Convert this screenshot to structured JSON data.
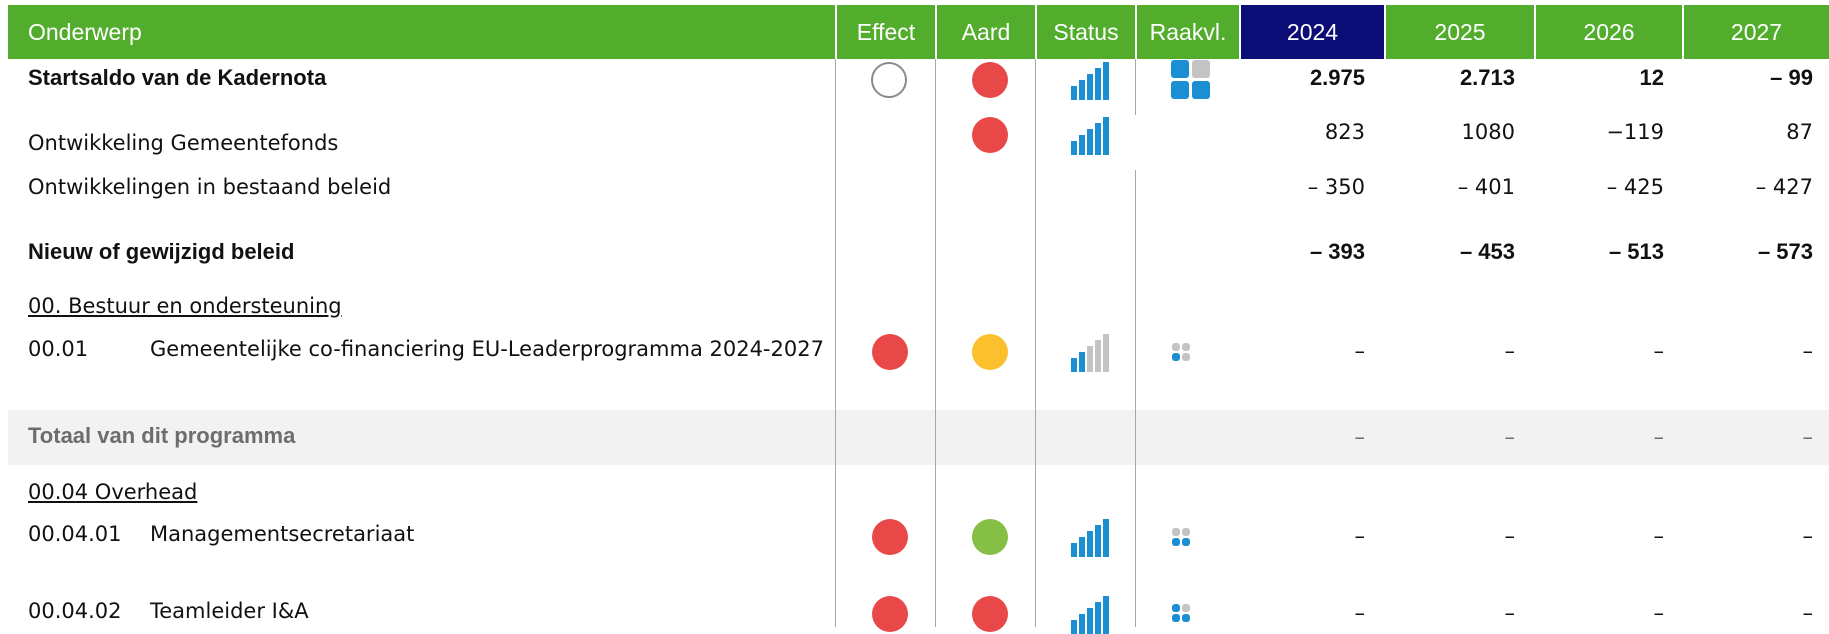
{
  "colors": {
    "header_green": "#52ad2d",
    "header_year_active": "#0b0c76",
    "red": "#e84848",
    "yellow": "#fbc02d",
    "green": "#86bf45",
    "blue": "#1b8fd2",
    "gray": "#c4c4c4",
    "total_bg": "#f2f2f2"
  },
  "header": {
    "onderwerp": "Onderwerp",
    "effect": "Effect",
    "aard": "Aard",
    "status": "Status",
    "raakvl": "Raakvl.",
    "y2024": "2024",
    "y2025": "2025",
    "y2026": "2026",
    "y2027": "2027"
  },
  "rows": {
    "startsaldo": {
      "label": "Startsaldo van de Kadernota",
      "effect": "empty-circle",
      "aard": "red",
      "status_level": 5,
      "raakvl": "large-tiles",
      "v2024": "2.975",
      "v2025": "2.713",
      "v2026": "12",
      "v2027": "– 99"
    },
    "gemeentefonds": {
      "label": "Ontwikkeling Gemeentefonds",
      "aard": "red",
      "status_level": 5,
      "v2024": "823",
      "v2025": "1080",
      "v2026": "−119",
      "v2027": "87"
    },
    "bestaand": {
      "label": "Ontwikkelingen in bestaand beleid",
      "v2024": "– 350",
      "v2025": "– 401",
      "v2026": "– 425",
      "v2027": "– 427"
    },
    "nieuw": {
      "label": "Nieuw of gewijzigd beleid",
      "v2024": "– 393",
      "v2025": "– 453",
      "v2026": "– 513",
      "v2027": "– 573"
    },
    "section1": {
      "label": "00. Bestuur en ondersteuning"
    },
    "item0001": {
      "code": "00.01",
      "label": "Gemeentelijke co-financiering EU-Leaderprogramma  2024-2027",
      "effect": "red",
      "aard": "yellow",
      "status_level": 2,
      "raakvl": "small-tiles",
      "v2024": "–",
      "v2025": "–",
      "v2026": "–",
      "v2027": "–"
    },
    "totaal": {
      "label": "Totaal van dit programma",
      "v2024": "–",
      "v2025": "–",
      "v2026": "–",
      "v2027": "–"
    },
    "section2": {
      "label": "00.04 Overhead"
    },
    "item000401": {
      "code": "00.04.01",
      "label": "Managementsecretariaat",
      "effect": "red",
      "aard": "green",
      "status_level": 5,
      "raakvl": "small-tiles",
      "v2024": "–",
      "v2025": "–",
      "v2026": "–",
      "v2027": "–"
    },
    "item000402": {
      "code": "00.04.02",
      "label": "Teamleider I&A",
      "effect": "red",
      "aard": "red",
      "status_level": 5,
      "raakvl": "small-tiles",
      "v2024": "–",
      "v2025": "–",
      "v2026": "–",
      "v2027": "–"
    }
  }
}
